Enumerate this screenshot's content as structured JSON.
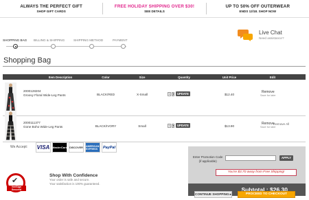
{
  "promos": [
    {
      "heading": "ALWAYS THE PERFECT GIFT",
      "sub": "SHOP GIFT CARDS",
      "color": "#222222"
    },
    {
      "heading": "FREE HOLIDAY SHIPPING OVER $30!",
      "sub": "SEE DETAILS",
      "color": "#e0218a"
    },
    {
      "heading": "UP TO 50% OFF OUTERWEAR",
      "sub": "ENDS 12/18. SHOP NOW",
      "color": "#222222"
    }
  ],
  "steps": [
    "SHOPPING BAG",
    "BILLING & SHIPPING",
    "SHIPPING METHOD",
    "PAYMENT"
  ],
  "chat": {
    "title": "Live Chat",
    "subtitle": "Need assistance?"
  },
  "page_title": "Shopping Bag",
  "table": {
    "headers": {
      "description": "Item Description",
      "color": "Color",
      "size": "Size",
      "quantity": "Quantity",
      "unit_price": "Unit Price",
      "edit": "Edit"
    },
    "rows": [
      {
        "sku": "2000128204",
        "name": "Groovy Floral Wide-Leg Pants",
        "color": "BLACK/RED",
        "size": "X-Small",
        "qty": "1",
        "update": "UPDATE",
        "price": "$12.40",
        "remove": "Remove",
        "save": "Save for later"
      },
      {
        "sku": "2000111377",
        "name": "Gone Boho Wide-Leg Pants",
        "color": "BLACK/IVORY",
        "size": "Small",
        "qty": "1",
        "update": "UPDATE",
        "price": "$13.90",
        "remove": "Remove",
        "save": "Save for later"
      }
    ]
  },
  "remove_all": "Remove All",
  "accept_label": "We Accept:",
  "cards": [
    "VISA",
    "MasterCard",
    "DISCOVER",
    "AMERICAN EXPRESS",
    "PayPal"
  ],
  "seal": {
    "text": "VeriSign Secured"
  },
  "confidence": {
    "title": "Shop With Confidence",
    "line1": "Your order is safe and secure.",
    "line2": "Your satisfaction is 100% guaranteed."
  },
  "promo_code": {
    "label": "Enter Promotion Code",
    "label2": "(if applicable)",
    "apply": "APPLY",
    "value": ""
  },
  "shipping_message": "You're $3.70 away from Free Shipping!",
  "subtotal": "Subtotal : $26.30",
  "buttons": {
    "continue": "CONTINUE SHOPPING ▸",
    "proceed": "PROCEED TO CHECKOUT"
  },
  "colors": {
    "accent_pink": "#e0218a",
    "chat_orange": "#f28c1e",
    "checkout_orange": "#f7a600",
    "shipping_red": "#c22222"
  }
}
